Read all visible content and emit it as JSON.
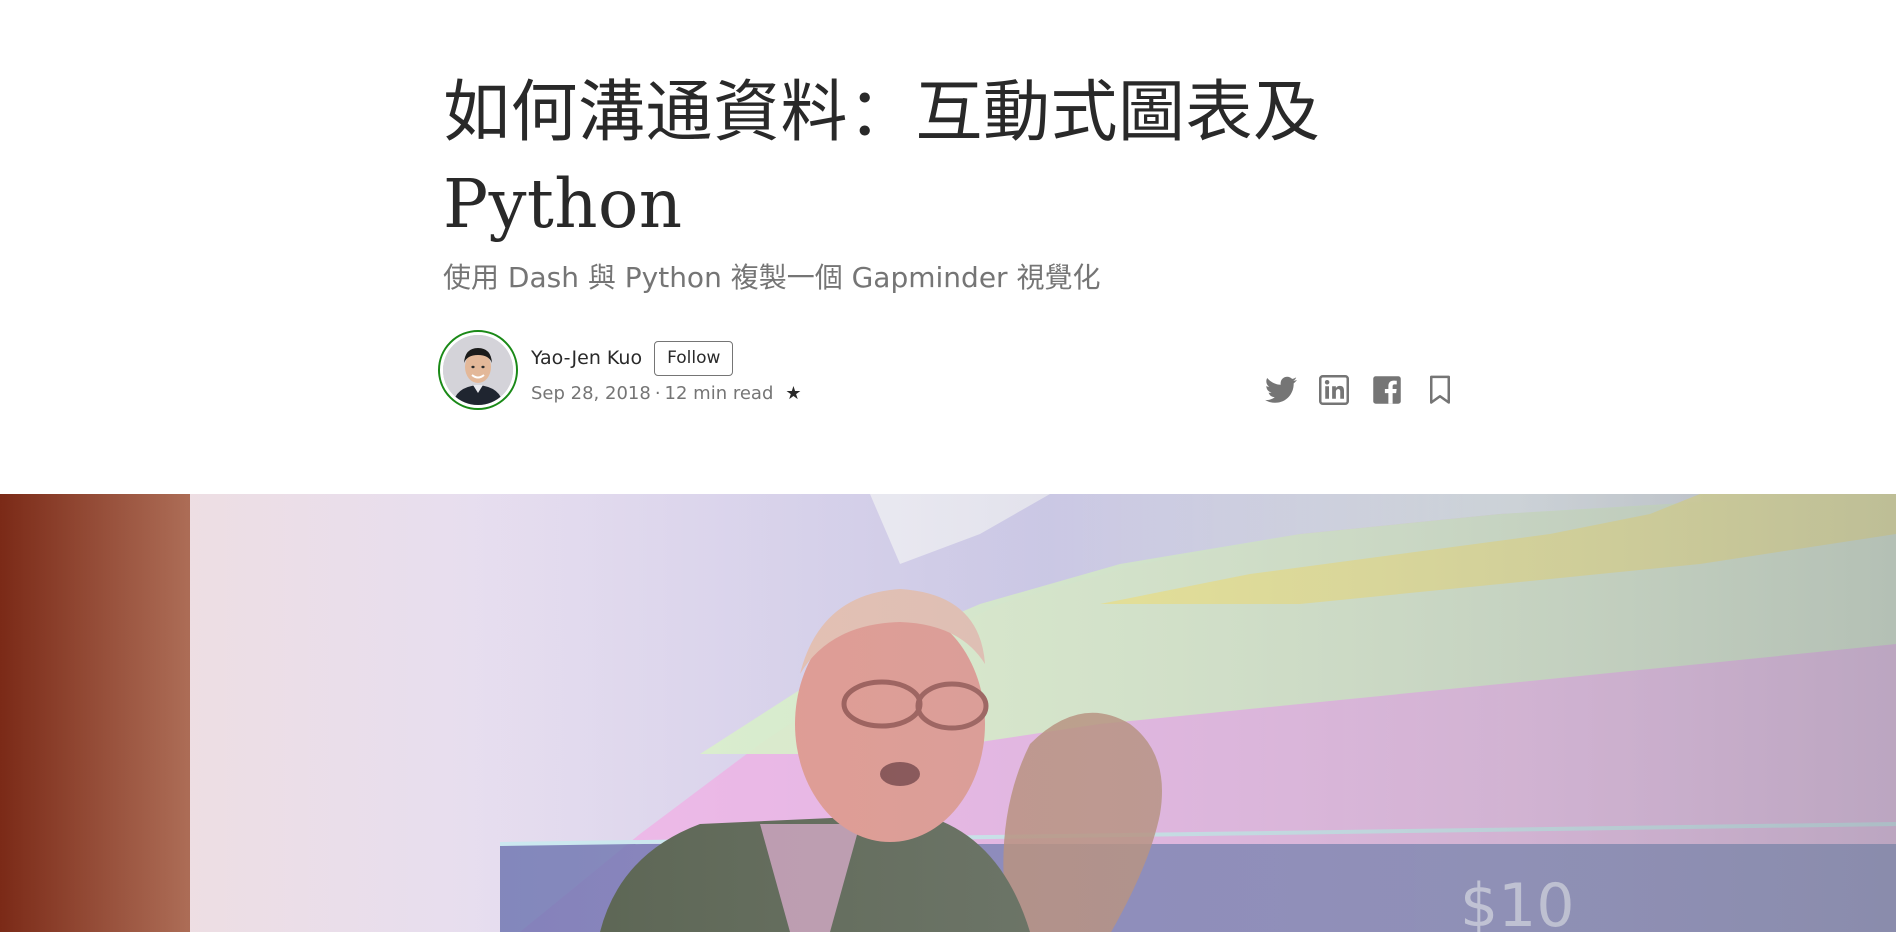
{
  "article": {
    "title": "如何溝通資料：互動式圖表及 Python",
    "subtitle": "使用 Dash 與 Python 複製一個 Gapminder 視覺化"
  },
  "author": {
    "name": "Yao-Jen Kuo",
    "follow_label": "Follow",
    "date": "Sep 28, 2018",
    "separator": "·",
    "read_time": "12 min read",
    "member_star": "★"
  },
  "share": {
    "icons": [
      "twitter-icon",
      "linkedin-icon",
      "facebook-icon",
      "bookmark-icon"
    ],
    "icon_color": "#757575"
  },
  "colors": {
    "text": "#292929",
    "muted": "#757575",
    "avatar_ring": "#1a8917"
  }
}
